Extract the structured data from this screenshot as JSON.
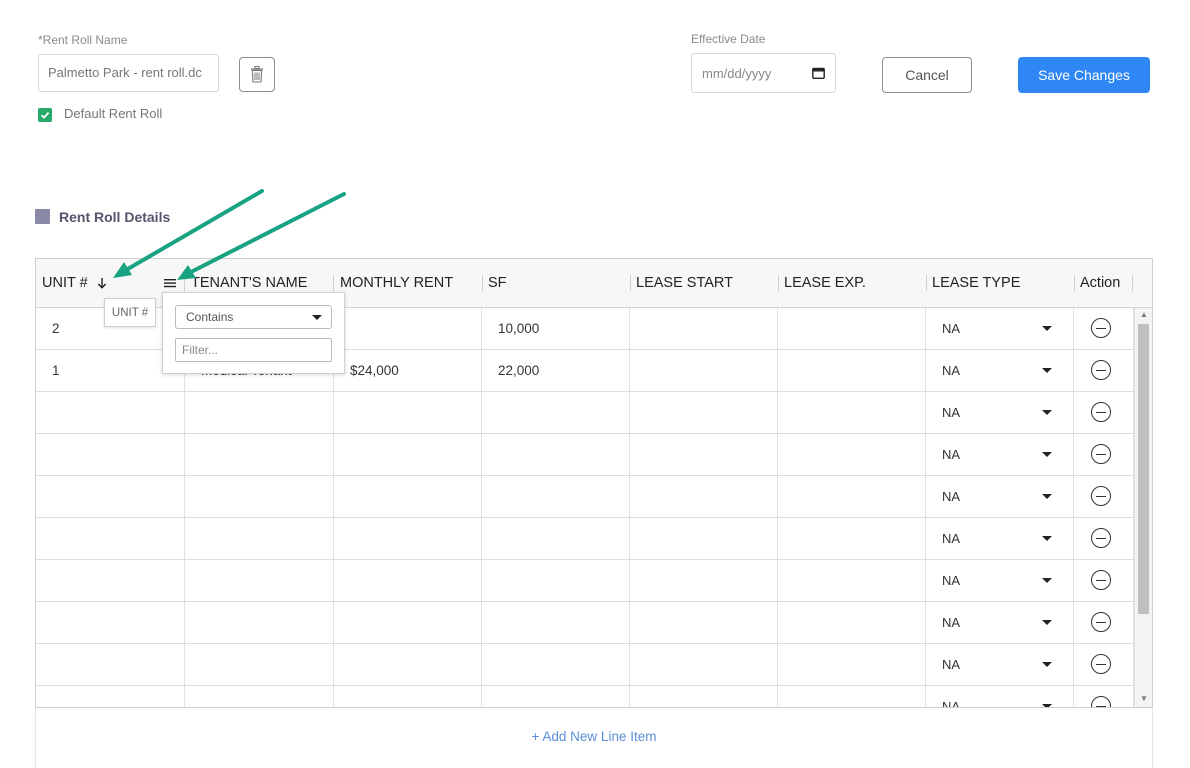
{
  "form": {
    "name_label": "*Rent Roll Name",
    "name_value": "Palmetto Park - rent roll.dc",
    "date_label": "Effective Date",
    "date_placeholder": "mm/dd/yyyy",
    "cancel_label": "Cancel",
    "save_label": "Save Changes",
    "default_label": "Default Rent Roll",
    "default_checked": true
  },
  "section": {
    "title": "Rent Roll Details"
  },
  "table": {
    "columns": [
      "UNIT #",
      "TENANT'S NAME",
      "MONTHLY RENT",
      "SF",
      "LEASE START",
      "LEASE EXP.",
      "LEASE TYPE",
      "Action"
    ],
    "sort_icon": "arrow-down-icon",
    "menu_icon": "hamburger-menu-icon",
    "rows": [
      {
        "unit": "2",
        "tenant": "",
        "rent": "",
        "sf": "10,000",
        "start": "",
        "exp": "",
        "type": "NA"
      },
      {
        "unit": "1",
        "tenant": "Medical Tenant",
        "rent": "$24,000",
        "sf": "22,000",
        "start": "",
        "exp": "",
        "type": "NA"
      },
      {
        "unit": "",
        "tenant": "",
        "rent": "",
        "sf": "",
        "start": "",
        "exp": "",
        "type": "NA"
      },
      {
        "unit": "",
        "tenant": "",
        "rent": "",
        "sf": "",
        "start": "",
        "exp": "",
        "type": "NA"
      },
      {
        "unit": "",
        "tenant": "",
        "rent": "",
        "sf": "",
        "start": "",
        "exp": "",
        "type": "NA"
      },
      {
        "unit": "",
        "tenant": "",
        "rent": "",
        "sf": "",
        "start": "",
        "exp": "",
        "type": "NA"
      },
      {
        "unit": "",
        "tenant": "",
        "rent": "",
        "sf": "",
        "start": "",
        "exp": "",
        "type": "NA"
      },
      {
        "unit": "",
        "tenant": "",
        "rent": "",
        "sf": "",
        "start": "",
        "exp": "",
        "type": "NA"
      },
      {
        "unit": "",
        "tenant": "",
        "rent": "",
        "sf": "",
        "start": "",
        "exp": "",
        "type": "NA"
      },
      {
        "unit": "",
        "tenant": "",
        "rent": "",
        "sf": "",
        "start": "",
        "exp": "",
        "type": "NA"
      }
    ],
    "add_label": "+ Add New Line Item"
  },
  "tooltip": {
    "text": "UNIT #"
  },
  "filter_menu": {
    "operator": "Contains",
    "placeholder": "Filter..."
  },
  "colors": {
    "accent": "#2f86f5",
    "check": "#27a86b",
    "annotation_arrow": "#1aa383"
  }
}
